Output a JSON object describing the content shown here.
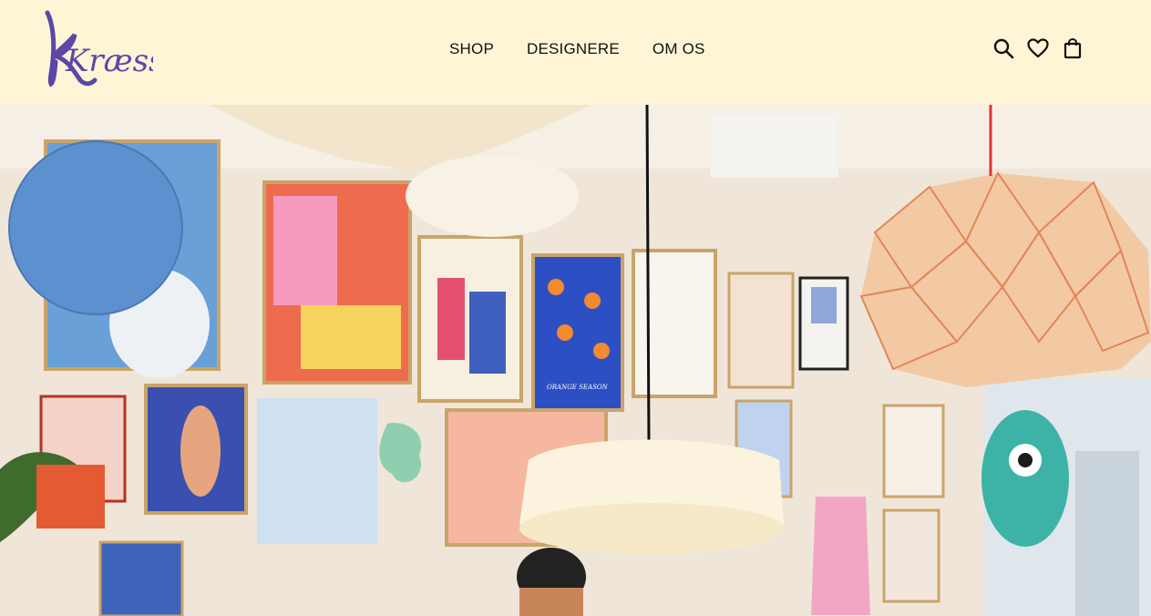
{
  "brand": {
    "name": "Kræss",
    "logo_color": "#5b47a8"
  },
  "nav": {
    "items": [
      {
        "label": "SHOP"
      },
      {
        "label": "DESIGNERE"
      },
      {
        "label": "OM OS"
      }
    ]
  },
  "header_icons": [
    "search-icon",
    "heart-icon",
    "shopping-bag-icon"
  ],
  "hero": {
    "poster_text": "ORANGE SEASON"
  },
  "colors": {
    "header_bg": "#fdf5d6",
    "text": "#111111"
  }
}
